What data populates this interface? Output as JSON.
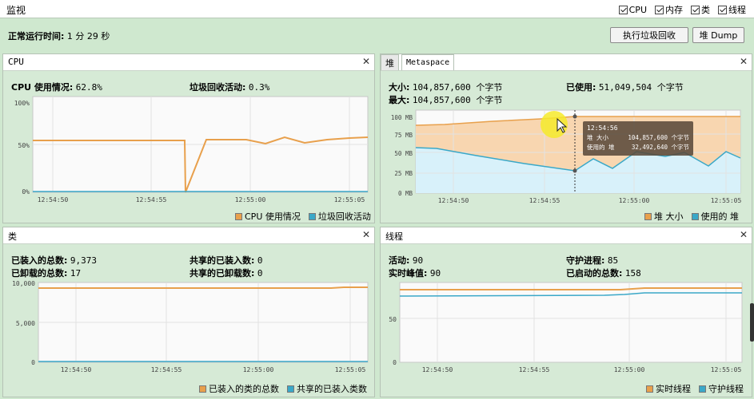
{
  "topbar": {
    "title": "监视",
    "checks": [
      {
        "label": "CPU",
        "checked": true
      },
      {
        "label": "内存",
        "checked": true
      },
      {
        "label": "类",
        "checked": true
      },
      {
        "label": "线程",
        "checked": true
      }
    ]
  },
  "uptime": {
    "label": "正常运行时间:",
    "value": "1 分 29 秒"
  },
  "buttons": {
    "gc": "执行垃圾回收",
    "heap_dump": "堆 Dump"
  },
  "colors": {
    "orange": "#e8a04c",
    "blue": "#3aa8c8",
    "heap_fill": "#f8d6b0",
    "used_fill": "#d8f1fa"
  },
  "cpu": {
    "title": "CPU",
    "usage_label": "CPU 使用情况:",
    "usage_value": "62.8%",
    "gc_label": "垃圾回收活动:",
    "gc_value": "0.3%",
    "yticks": [
      "100%",
      "50%",
      "0%"
    ],
    "xticks": [
      "12:54:50",
      "12:54:55",
      "12:55:00",
      "12:55:05"
    ],
    "legend": [
      "CPU 使用情况",
      "垃圾回收活动"
    ]
  },
  "memory": {
    "tabs": [
      "堆",
      "Metaspace"
    ],
    "size_label": "大小:",
    "size_value": "104,857,600 个字节",
    "max_label": "最大:",
    "max_value": "104,857,600 个字节",
    "used_label": "已使用:",
    "used_value": "51,049,504 个字节",
    "yticks": [
      "100 MB",
      "75 MB",
      "50 MB",
      "25 MB",
      "0 MB"
    ],
    "xticks": [
      "12:54:50",
      "12:54:55",
      "12:55:00",
      "12:55:05"
    ],
    "tooltip": {
      "time": "12:54:56",
      "row1_label": "堆 大小",
      "row1_value": "104,857,600 个字节",
      "row2_label": "使用的 堆",
      "row2_value": "32,492,640 个字节"
    },
    "legend": [
      "堆 大小",
      "使用的 堆"
    ]
  },
  "classes": {
    "title": "类",
    "loaded_label": "已装入的总数:",
    "loaded_value": "9,373",
    "unloaded_label": "已卸载的总数:",
    "unloaded_value": "17",
    "shared_loaded_label": "共享的已装入数:",
    "shared_loaded_value": "0",
    "shared_unloaded_label": "共享的已卸载数:",
    "shared_unloaded_value": "0",
    "yticks": [
      "10,000",
      "5,000",
      "0"
    ],
    "xticks": [
      "12:54:50",
      "12:54:55",
      "12:55:00",
      "12:55:05"
    ],
    "legend": [
      "已装入的类的总数",
      "共享的已装入类数"
    ]
  },
  "threads": {
    "title": "线程",
    "live_label": "活动:",
    "live_value": "90",
    "peak_label": "实时峰值:",
    "peak_value": "90",
    "daemon_label": "守护进程:",
    "daemon_value": "85",
    "started_label": "已启动的总数:",
    "started_value": "158",
    "yticks": [
      "50",
      "0"
    ],
    "xticks": [
      "12:54:50",
      "12:54:55",
      "12:55:00",
      "12:55:05"
    ],
    "legend": [
      "实时线程",
      "守护线程"
    ]
  }
}
